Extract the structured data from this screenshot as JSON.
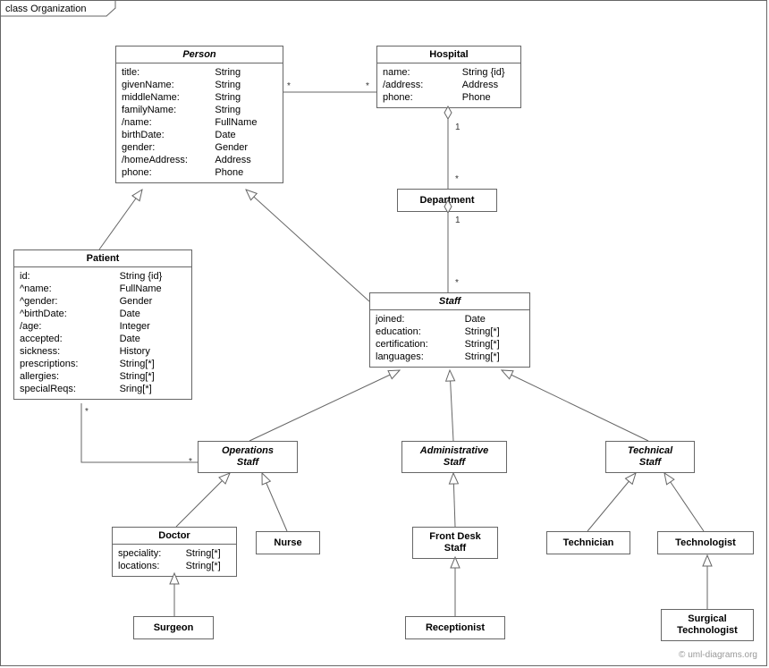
{
  "frame": {
    "label": "class Organization"
  },
  "classes": {
    "person": {
      "title": "Person",
      "attrs": [
        {
          "n": "title:",
          "t": "String"
        },
        {
          "n": "givenName:",
          "t": "String"
        },
        {
          "n": "middleName:",
          "t": "String"
        },
        {
          "n": "familyName:",
          "t": "String"
        },
        {
          "n": "/name:",
          "t": "FullName"
        },
        {
          "n": "birthDate:",
          "t": "Date"
        },
        {
          "n": "gender:",
          "t": "Gender"
        },
        {
          "n": "/homeAddress:",
          "t": "Address"
        },
        {
          "n": "phone:",
          "t": "Phone"
        }
      ]
    },
    "hospital": {
      "title": "Hospital",
      "attrs": [
        {
          "n": "name:",
          "t": "String {id}"
        },
        {
          "n": "/address:",
          "t": "Address"
        },
        {
          "n": "phone:",
          "t": "Phone"
        }
      ]
    },
    "department": {
      "title": "Department"
    },
    "patient": {
      "title": "Patient",
      "attrs": [
        {
          "n": "id:",
          "t": "String {id}"
        },
        {
          "n": "^name:",
          "t": "FullName"
        },
        {
          "n": "^gender:",
          "t": "Gender"
        },
        {
          "n": "^birthDate:",
          "t": "Date"
        },
        {
          "n": "/age:",
          "t": "Integer"
        },
        {
          "n": "accepted:",
          "t": "Date"
        },
        {
          "n": "sickness:",
          "t": "History"
        },
        {
          "n": "prescriptions:",
          "t": "String[*]"
        },
        {
          "n": "allergies:",
          "t": "String[*]"
        },
        {
          "n": "specialReqs:",
          "t": "Sring[*]"
        }
      ]
    },
    "staff": {
      "title": "Staff",
      "attrs": [
        {
          "n": "joined:",
          "t": "Date"
        },
        {
          "n": "education:",
          "t": "String[*]"
        },
        {
          "n": "certification:",
          "t": "String[*]"
        },
        {
          "n": "languages:",
          "t": "String[*]"
        }
      ]
    },
    "opsStaff": {
      "title1": "Operations",
      "title2": "Staff"
    },
    "adminStaff": {
      "title1": "Administrative",
      "title2": "Staff"
    },
    "techStaff": {
      "title1": "Technical",
      "title2": "Staff"
    },
    "doctor": {
      "title": "Doctor",
      "attrs": [
        {
          "n": "speciality:",
          "t": "String[*]"
        },
        {
          "n": "locations:",
          "t": "String[*]"
        }
      ]
    },
    "nurse": {
      "title": "Nurse"
    },
    "frontDesk": {
      "title1": "Front Desk",
      "title2": "Staff"
    },
    "technician": {
      "title": "Technician"
    },
    "technologist": {
      "title": "Technologist"
    },
    "surgeon": {
      "title": "Surgeon"
    },
    "receptionist": {
      "title": "Receptionist"
    },
    "surgTech": {
      "title1": "Surgical",
      "title2": "Technologist"
    }
  },
  "mult": {
    "person_r": "*",
    "hospital_l": "*",
    "hosp_dept_top": "1",
    "hosp_dept_bot": "*",
    "dept_staff_top": "1",
    "dept_staff_bot": "*",
    "patient_b": "*",
    "ops_t": "*"
  },
  "watermark": "© uml-diagrams.org"
}
